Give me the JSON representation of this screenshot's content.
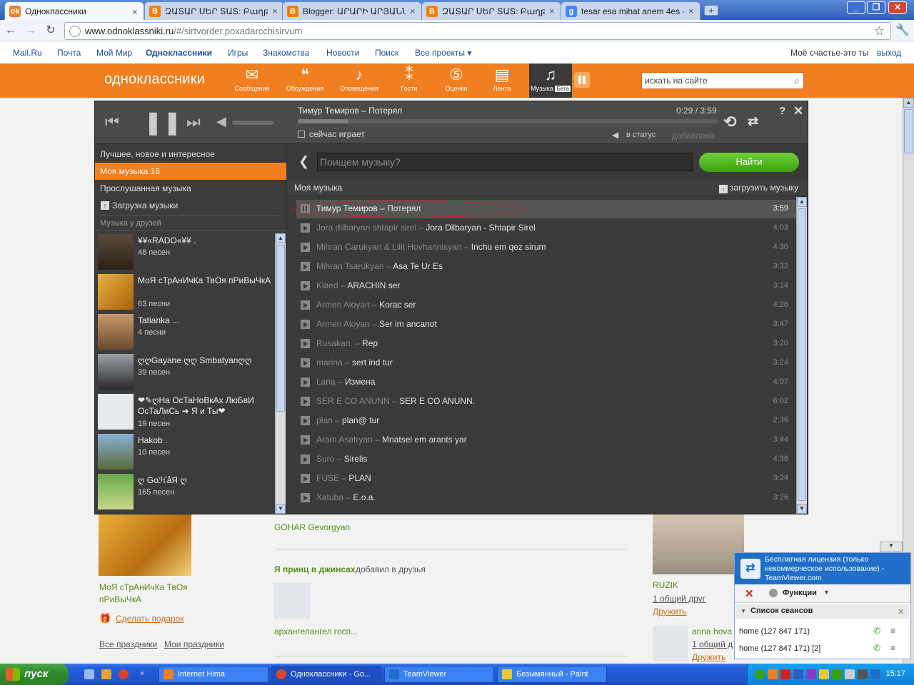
{
  "browser": {
    "tabs": [
      {
        "title": "Одноклассники",
        "icon": "odnoklassniki-icon",
        "color": "#f17f1f",
        "glyph": "ok"
      },
      {
        "title": "ԶԱՏԱՐ ՍԵՐ ՏԱՏ: Բաղթ՞ն ...",
        "icon": "blogger-icon",
        "color": "#f57d00",
        "glyph": "B"
      },
      {
        "title": "Blogger: ԱՐԱՐԻ ԱՐՅԱՆՆԵ...",
        "icon": "blogger-icon",
        "color": "#f57d00",
        "glyph": "B"
      },
      {
        "title": "ԶԱՏԱՐ ՍԵՐ ՏԱՏ: Բաղթ՞ն ...",
        "icon": "blogger-icon",
        "color": "#f57d00",
        "glyph": "B"
      },
      {
        "title": "tesar esa mihat anem 4es -...",
        "icon": "google-icon",
        "color": "#4285f4",
        "glyph": "g"
      }
    ],
    "url_host": "www.odnoklassniki.ru",
    "url_path": "/#/sirtvorder.poxadarcchisirvum"
  },
  "topnav": {
    "items": [
      "Mail.Ru",
      "Почта",
      "Мой Мир",
      "Одноклассники",
      "Игры",
      "Знакомства",
      "Новости",
      "Поиск",
      "Все проекты ▾"
    ],
    "status": "Моё счастье-это ты",
    "logout": "выход"
  },
  "ok": {
    "logo": "одноклассники",
    "nav": [
      {
        "label": "Сообщения",
        "icon": "envelope-icon",
        "glyph": "✉"
      },
      {
        "label": "Обсуждения",
        "icon": "speech-bubbles-icon",
        "glyph": "💬"
      },
      {
        "label": "Оповещения",
        "icon": "bell-icon",
        "glyph": "🔔"
      },
      {
        "label": "Гости",
        "icon": "footprints-icon",
        "glyph": "👣"
      },
      {
        "label": "Оценки",
        "icon": "rating-five-icon",
        "glyph": "⑤"
      },
      {
        "label": "Лента",
        "icon": "feed-icon",
        "glyph": "📄"
      }
    ],
    "music_label": "Музыка",
    "beta": "Бета",
    "search_placeholder": "искать на сайте"
  },
  "player": {
    "now_title": "Тимур Темиров – Потерял",
    "time": "0:29 / 3:59",
    "progress": 0.12,
    "now_playing": "сейчас играет",
    "to_status": "в статус",
    "added": "добавлена",
    "help": "?",
    "close": "✕"
  },
  "sidebar": {
    "items": [
      "Лучшее, новое и интересное",
      "Моя музыка 16",
      "Прослушанная музыка",
      "Загрузка музыки"
    ],
    "friends_header": "Музыка у друзей",
    "friends": [
      {
        "name": "¥¥«RADO«¥¥ .",
        "count": "48 песен"
      },
      {
        "name": "МоЯ сТрАнИчКа ТвОя пРиВыЧкА",
        "count": "63 песни"
      },
      {
        "name": "Tatianka ...",
        "count": "4 песни"
      },
      {
        "name": "ღღGayane ღღ Smbatyanღღ",
        "count": "39 песен"
      },
      {
        "name": "❤✎ღНа ОсТаНоВкАх ЛюБвИ ОсТаЛиСь ➜ Я и Ты❤",
        "count": "19 песен"
      },
      {
        "name": "Hakob .",
        "count": "10 песен"
      },
      {
        "name": "ღ GoℋåЯ ღ",
        "count": "165 песен"
      }
    ]
  },
  "music": {
    "search_placeholder": "Поищем музыку?",
    "find": "Найти",
    "list_title": "Моя музыка",
    "upload": "загрузить музыку",
    "tracks": [
      {
        "artist": "Тимур Темиров",
        "song": "Потерял",
        "dur": "3:59"
      },
      {
        "artist": "Jora dilbaryan shtapir sirel",
        "song": "Jora Dilbaryan - Shtapir Sirel",
        "dur": "4:03"
      },
      {
        "artist": "Mihran Carukyan & Lilit Hovhannisyan",
        "song": "Inchu em qez sirum",
        "dur": "4:30"
      },
      {
        "artist": "Mihran Tsarukyan",
        "song": "Asa Te Ur Es",
        "dur": "3:32"
      },
      {
        "artist": "Klaed",
        "song": "ARACHIN ser",
        "dur": "3:14"
      },
      {
        "artist": "Armen Aloyan",
        "song": "Korac ser",
        "dur": "4:26"
      },
      {
        "artist": "Armen Aloyan",
        "song": "Ser im ancanot",
        "dur": "3:47"
      },
      {
        "artist": "Rusakan.",
        "song": "Rep",
        "dur": "3:20"
      },
      {
        "artist": "marina",
        "song": "sert ind tur",
        "dur": "3:24"
      },
      {
        "artist": "Lana",
        "song": "Измена",
        "dur": "4:07"
      },
      {
        "artist": "SER E CO ANUNN",
        "song": "SER E CO ANUNN.",
        "dur": "6:02"
      },
      {
        "artist": "plan",
        "song": "plan@ tur",
        "dur": "2:36"
      },
      {
        "artist": "Aram Asatryan",
        "song": "Mnatsel em arants yar",
        "dur": "3:44"
      },
      {
        "artist": "Suro",
        "song": "Sirelis",
        "dur": "4:36"
      },
      {
        "artist": "FUSE",
        "song": "PLAN",
        "dur": "3:24"
      },
      {
        "artist": "Xatuba",
        "song": "E.o.a.",
        "dur": "3:26"
      }
    ]
  },
  "background": {
    "friend_name": "МоЯ сТрАнИчКа ТвОя пРиВыЧкА",
    "gift": "Сделать подарок",
    "holidays": "Все праздники",
    "my_holidays": "Мои праздники",
    "gohar": "GOHAR Gevorgyan",
    "prince": "Я принц в джинсах",
    "added_friends": "добавил в друзья",
    "archangel": "архангелангел госп...",
    "ruzik": "RUZIK",
    "common_friend": "1 общий друг",
    "befriend": "Дружить",
    "anna": "anna hova",
    "common_friend2": "1 общий д",
    "befriend2": "Дружить"
  },
  "teamviewer": {
    "license": "Бесплатная лицензия (только некоммерческое использование) - TeamViewer.com",
    "functions": "Функции",
    "sessions": "Список сеансов",
    "rows": [
      "home (127 847 171)",
      "home (127 847 171) [2]"
    ]
  },
  "taskbar": {
    "start": "пуск",
    "tasks": [
      "Internet Hima",
      "Одноклассники - Go...",
      "TeamViewer",
      "Безымянный - Paint"
    ],
    "clock": "15:17"
  }
}
